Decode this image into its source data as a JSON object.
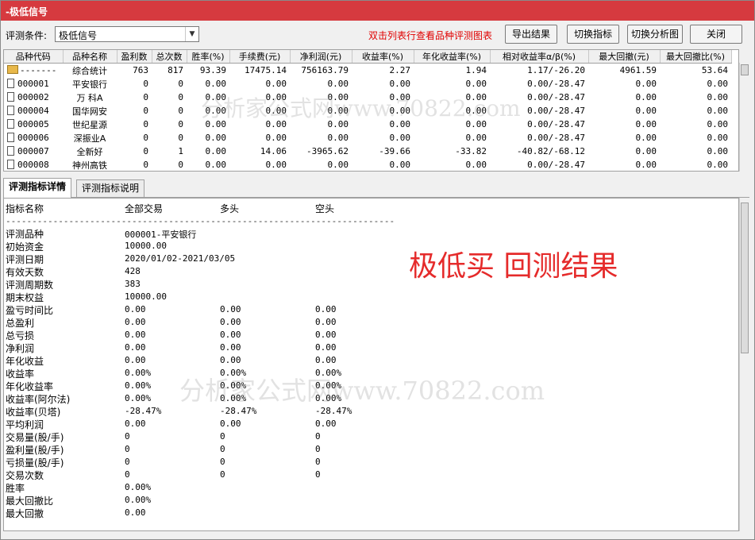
{
  "window": {
    "title": "-极低信号"
  },
  "toolbar": {
    "condition_label": "评测条件:",
    "condition_value": "极低信号",
    "hint": "双击列表行查看品种评测图表",
    "export_btn": "导出结果",
    "switch_indicator_btn": "切换指标",
    "switch_chart_btn": "切换分析图",
    "close_btn": "关闭"
  },
  "grid": {
    "headers": [
      "品种代码",
      "品种名称",
      "盈利数",
      "总次数",
      "胜率(%)",
      "手续费(元)",
      "净利润(元)",
      "收益率(%)",
      "年化收益率(%)",
      "相对收益率α/β(%)",
      "最大回撤(元)",
      "最大回撤比(%)"
    ],
    "rows": [
      [
        "-------",
        "综合统计",
        "763",
        "817",
        "93.39",
        "17475.14",
        "756163.79",
        "2.27",
        "1.94",
        "1.17/-26.20",
        "4961.59",
        "53.64"
      ],
      [
        "000001",
        "平安银行",
        "0",
        "0",
        "0.00",
        "0.00",
        "0.00",
        "0.00",
        "0.00",
        "0.00/-28.47",
        "0.00",
        "0.00"
      ],
      [
        "000002",
        "万 科A",
        "0",
        "0",
        "0.00",
        "0.00",
        "0.00",
        "0.00",
        "0.00",
        "0.00/-28.47",
        "0.00",
        "0.00"
      ],
      [
        "000004",
        "国华网安",
        "0",
        "0",
        "0.00",
        "0.00",
        "0.00",
        "0.00",
        "0.00",
        "0.00/-28.47",
        "0.00",
        "0.00"
      ],
      [
        "000005",
        "世纪星源",
        "0",
        "0",
        "0.00",
        "0.00",
        "0.00",
        "0.00",
        "0.00",
        "0.00/-28.47",
        "0.00",
        "0.00"
      ],
      [
        "000006",
        "深振业A",
        "0",
        "0",
        "0.00",
        "0.00",
        "0.00",
        "0.00",
        "0.00",
        "0.00/-28.47",
        "0.00",
        "0.00"
      ],
      [
        "000007",
        "全新好",
        "0",
        "1",
        "0.00",
        "14.06",
        "-3965.62",
        "-39.66",
        "-33.82",
        "-40.82/-68.12",
        "0.00",
        "0.00"
      ],
      [
        "000008",
        "神州高铁",
        "0",
        "0",
        "0.00",
        "0.00",
        "0.00",
        "0.00",
        "0.00",
        "0.00/-28.47",
        "0.00",
        "0.00"
      ]
    ]
  },
  "tabs": {
    "detail": "评测指标详情",
    "explain": "评测指标说明"
  },
  "detail": {
    "header": {
      "name": "指标名称",
      "all": "全部交易",
      "long": "多头",
      "short": "空头"
    },
    "dashes": "--------------------------------------------------------------------------",
    "info": [
      {
        "k": "评测品种",
        "v": "000001-平安银行"
      },
      {
        "k": "初始资金",
        "v": "10000.00"
      },
      {
        "k": "评测日期",
        "v": "2020/01/02-2021/03/05"
      },
      {
        "k": "有效天数",
        "v": "428"
      },
      {
        "k": "评测周期数",
        "v": "383"
      },
      {
        "k": "期末权益",
        "v": "10000.00"
      }
    ],
    "metrics": [
      {
        "k": "盈亏时间比",
        "a": "0.00",
        "b": "0.00",
        "c": "0.00"
      },
      {
        "k": "总盈利",
        "a": "0.00",
        "b": "0.00",
        "c": "0.00"
      },
      {
        "k": "总亏损",
        "a": "0.00",
        "b": "0.00",
        "c": "0.00"
      },
      {
        "k": "净利润",
        "a": "0.00",
        "b": "0.00",
        "c": "0.00"
      },
      {
        "k": "年化收益",
        "a": "0.00",
        "b": "0.00",
        "c": "0.00"
      },
      {
        "k": "收益率",
        "a": "0.00%",
        "b": "0.00%",
        "c": "0.00%"
      },
      {
        "k": "年化收益率",
        "a": "0.00%",
        "b": "0.00%",
        "c": "0.00%"
      },
      {
        "k": "收益率(阿尔法)",
        "a": "0.00%",
        "b": "0.00%",
        "c": "0.00%"
      },
      {
        "k": "收益率(贝塔)",
        "a": "-28.47%",
        "b": "-28.47%",
        "c": "-28.47%"
      },
      {
        "k": "平均利润",
        "a": "0.00",
        "b": "0.00",
        "c": "0.00"
      },
      {
        "k": "交易量(股/手)",
        "a": "0",
        "b": "0",
        "c": "0"
      },
      {
        "k": "盈利量(股/手)",
        "a": "0",
        "b": "0",
        "c": "0"
      },
      {
        "k": "亏损量(股/手)",
        "a": "0",
        "b": "0",
        "c": "0"
      },
      {
        "k": "交易次数",
        "a": "0",
        "b": "0",
        "c": "0"
      },
      {
        "k": "胜率",
        "a": "0.00%",
        "b": "",
        "c": ""
      },
      {
        "k": "最大回撤比",
        "a": "0.00%",
        "b": "",
        "c": ""
      },
      {
        "k": "最大回撤",
        "a": "0.00",
        "b": "",
        "c": ""
      }
    ],
    "banner": "极低买  回测结果"
  },
  "watermarks": {
    "top": "分析家公式网www.70822.com",
    "bottom": "分析家公式网www.70822.com"
  }
}
